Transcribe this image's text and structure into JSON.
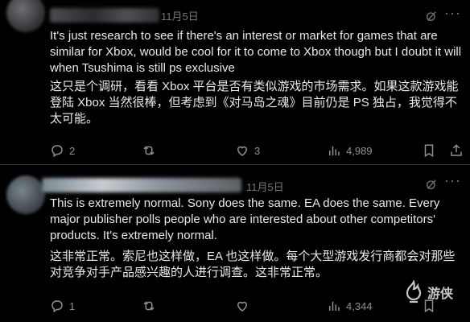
{
  "posts": [
    {
      "date": "11月5日",
      "text_en": "It's just research to see if there's an interest or market for games that are similar for Xbox, would be cool for it to come to Xbox though but I doubt it will when Tsushima is still ps exclusive",
      "text_zh": "这只是个调研，看看 Xbox 平台是否有类似游戏的市场需求。如果这款游戏能登陆 Xbox 当然很棒，但考虑到《对马岛之魂》目前仍是 PS 独占，我觉得不太可能。",
      "replies": "2",
      "reposts": "",
      "likes": "3",
      "views": "4,989"
    },
    {
      "date": "11月5日",
      "text_en": "This is extremely normal. Sony does the same. EA does the same. Every major publisher polls people who are interested about other competitors' products. It's extremely normal.",
      "text_zh": "这非常正常。索尼也这样做，EA 也这样做。每个大型游戏发行商都会对那些对竞争对手产品感兴趣的人进行调查。这非常正常。",
      "replies": "1",
      "reposts": "",
      "likes": "",
      "views": "4,344"
    }
  ],
  "watermark": {
    "text": "游侠"
  },
  "icons": [
    "grok-icon",
    "more-icon",
    "reply-icon",
    "repost-icon",
    "like-icon",
    "views-icon",
    "bookmark-icon",
    "share-icon"
  ]
}
